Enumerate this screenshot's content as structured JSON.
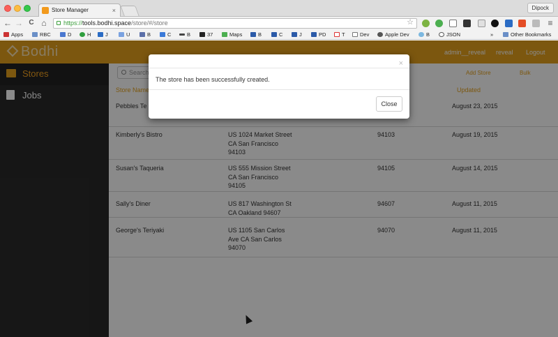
{
  "browser": {
    "tab_title": "Store Manager",
    "tab_close": "×",
    "profile_name": "Dipock",
    "url_scheme": "https://",
    "url_host": "tools.bodhi.space",
    "url_path": "/store/#/store",
    "back_icon": "←",
    "forward_icon": "→",
    "reload_icon": "C",
    "home_icon": "⌂",
    "star_icon": "☆",
    "menu_icon": "≡"
  },
  "bookmarks": {
    "apps_label": "Apps",
    "items": [
      "RBC",
      "D",
      "H",
      "J",
      "U",
      "B",
      "C",
      "B",
      "37",
      "Maps",
      "B",
      "C",
      "J",
      "PD",
      "T",
      "Dev",
      "Apple Dev",
      "B",
      "JSON"
    ],
    "overflow": "»",
    "other": "Other Bookmarks"
  },
  "app": {
    "logo": "Bodhi",
    "user": "admin__reveal",
    "org": "reveal",
    "logout": "Logout",
    "accent": "#e5a21d"
  },
  "sidebar": {
    "items": [
      {
        "label": "Stores",
        "icon": "store-icon"
      },
      {
        "label": "Jobs",
        "icon": "jobs-icon"
      }
    ]
  },
  "main": {
    "search_placeholder": "Search",
    "add_store": "Add Store",
    "bulk": "Bulk",
    "columns": [
      "Store Name",
      "Updated"
    ],
    "rows": [
      {
        "name": "Pebbles Te",
        "address": [
          "",
          "",
          ""
        ],
        "zip": "",
        "updated": "August 23, 2015"
      },
      {
        "name": "Kimberly's Bistro",
        "address": [
          "US 1024 Market Street",
          "CA San Francisco",
          "94103"
        ],
        "zip": "94103",
        "updated": "August 19, 2015"
      },
      {
        "name": "Susan's Taqueria",
        "address": [
          "US 555 Mission Street",
          "CA San Francisco",
          "94105"
        ],
        "zip": "94105",
        "updated": "August 14, 2015"
      },
      {
        "name": "Sally's Diner",
        "address": [
          "US 817 Washington St",
          "CA Oakland 94607",
          ""
        ],
        "zip": "94607",
        "updated": "August 11, 2015"
      },
      {
        "name": "George's Teriyaki",
        "address": [
          "US 1105 San Carlos",
          "Ave CA San Carlos",
          "94070"
        ],
        "zip": "94070",
        "updated": "August 11, 2015"
      }
    ]
  },
  "modal": {
    "message": "The store has been successfully created.",
    "close_x": "×",
    "close_button": "Close"
  }
}
